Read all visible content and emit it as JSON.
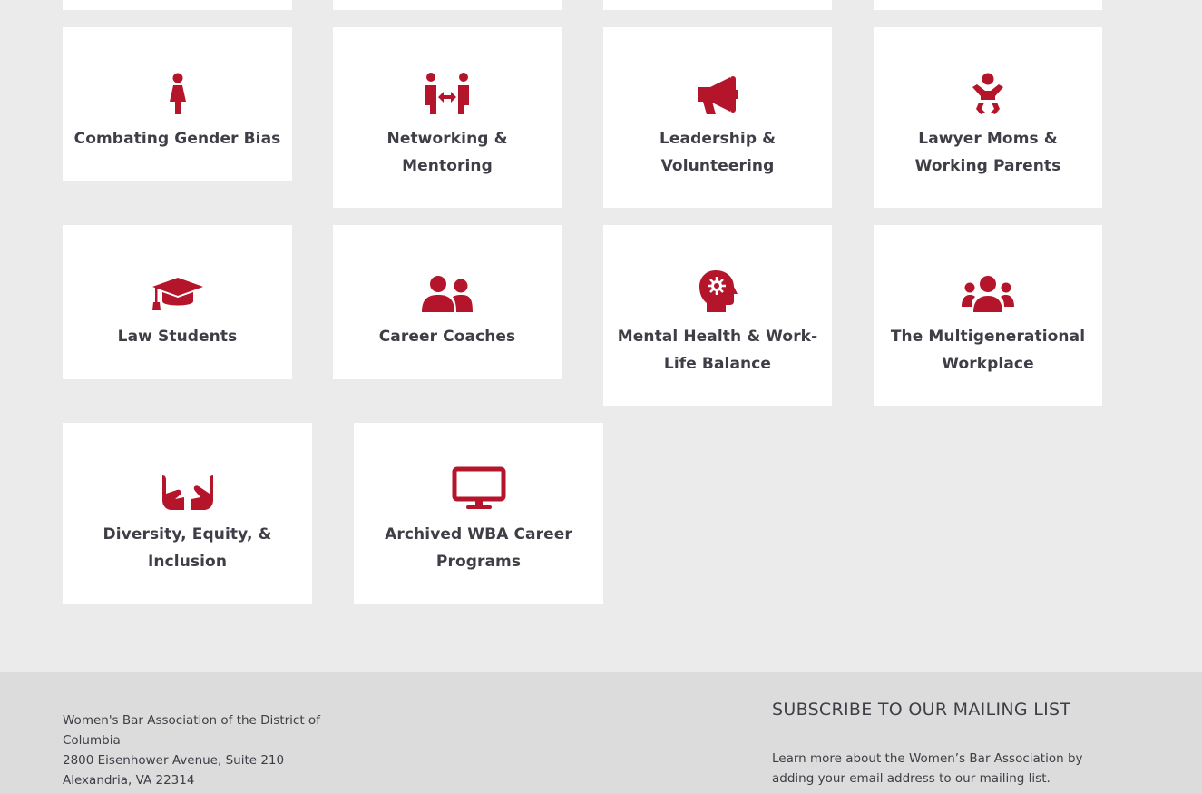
{
  "accent_color": "#b5152b",
  "cards": [
    {
      "label": "Combating Gender Bias",
      "icon": "female-person-icon"
    },
    {
      "label": "Networking & Mentoring",
      "icon": "networking-people-icon"
    },
    {
      "label": "Leadership & Volunteering",
      "icon": "megaphone-icon"
    },
    {
      "label": "Lawyer Moms & Working Parents",
      "icon": "baby-icon"
    },
    {
      "label": "Law Students",
      "icon": "graduation-cap-icon"
    },
    {
      "label": "Career Coaches",
      "icon": "user-group-icon"
    },
    {
      "label": "Mental Health & Work-Life Balance",
      "icon": "head-brain-icon"
    },
    {
      "label": "The Multigenerational Workplace",
      "icon": "users-group-icon"
    },
    {
      "label": "Diversity, Equity, & Inclusion",
      "icon": "open-hands-icon"
    },
    {
      "label": "Archived WBA Career Programs",
      "icon": "desktop-monitor-icon"
    }
  ],
  "footer": {
    "address_line1": "Women's Bar Association of the District of Columbia",
    "address_line2": "2800 Eisenhower Avenue, Suite 210",
    "address_line3": "Alexandria, VA 22314",
    "subscribe_title": "SUBSCRIBE TO OUR MAILING LIST",
    "subscribe_text": "Learn more about the Women’s Bar Association by adding your email address to our mailing list."
  }
}
